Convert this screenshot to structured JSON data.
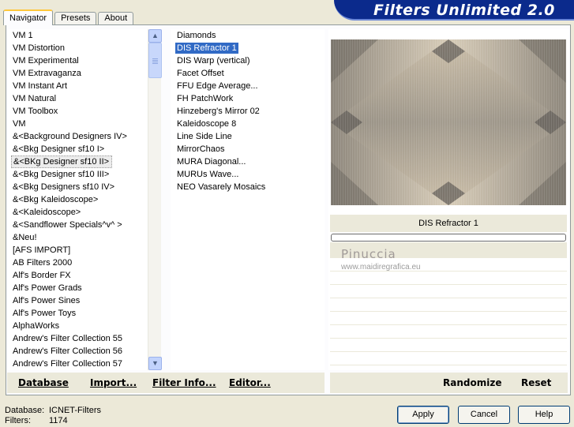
{
  "tabs": [
    {
      "label": "Navigator",
      "active": true
    },
    {
      "label": "Presets",
      "active": false
    },
    {
      "label": "About",
      "active": false
    }
  ],
  "banner": {
    "title": "Filters Unlimited 2.0"
  },
  "categories": [
    "VM 1",
    "VM Distortion",
    "VM Experimental",
    "VM Extravaganza",
    "VM Instant Art",
    "VM Natural",
    "VM Toolbox",
    "VM",
    "&<Background Designers IV>",
    "&<Bkg Designer sf10 I>",
    "&<BKg Designer sf10 II>",
    "&<Bkg Designer sf10 III>",
    "&<Bkg Designers sf10 IV>",
    "&<Bkg Kaleidoscope>",
    "&<Kaleidoscope>",
    "&<Sandflower Specials^v^ >",
    "&Neu!",
    "[AFS IMPORT]",
    "AB Filters 2000",
    "Alf's Border FX",
    "Alf's Power Grads",
    "Alf's Power Sines",
    "Alf's Power Toys",
    "AlphaWorks",
    "Andrew's Filter Collection 55",
    "Andrew's Filter Collection 56",
    "Andrew's Filter Collection 57"
  ],
  "selected_category_index": 10,
  "filters": [
    "Diamonds",
    "DIS Refractor 1",
    "DIS Warp (vertical)",
    "Facet Offset",
    "FFU Edge Average...",
    "FH PatchWork",
    "Hinzeberg's Mirror 02",
    "Kaleidoscope 8",
    "Line Side Line",
    "MirrorChaos",
    "MURA Diagonal...",
    "MURUs Wave...",
    "NEO Vasarely Mosaics"
  ],
  "selected_filter_index": 1,
  "preview": {
    "filter_name": "DIS Refractor 1"
  },
  "watermark": {
    "name": "Pinuccia",
    "url": "www.maidiregrafica.eu"
  },
  "bottom_left_buttons": {
    "database": "Database",
    "import": "Import...",
    "filter_info": "Filter Info...",
    "editor": "Editor..."
  },
  "bottom_right_buttons": {
    "randomize": "Randomize",
    "reset": "Reset"
  },
  "status": {
    "database_label": "Database:",
    "database_value": "ICNET-Filters",
    "filters_label": "Filters:",
    "filters_value": "1174"
  },
  "dialog_buttons": {
    "apply": "Apply",
    "cancel": "Cancel",
    "help": "Help"
  },
  "icons": {
    "scroll_up": "chevron-up-icon",
    "scroll_down": "chevron-down-icon"
  }
}
